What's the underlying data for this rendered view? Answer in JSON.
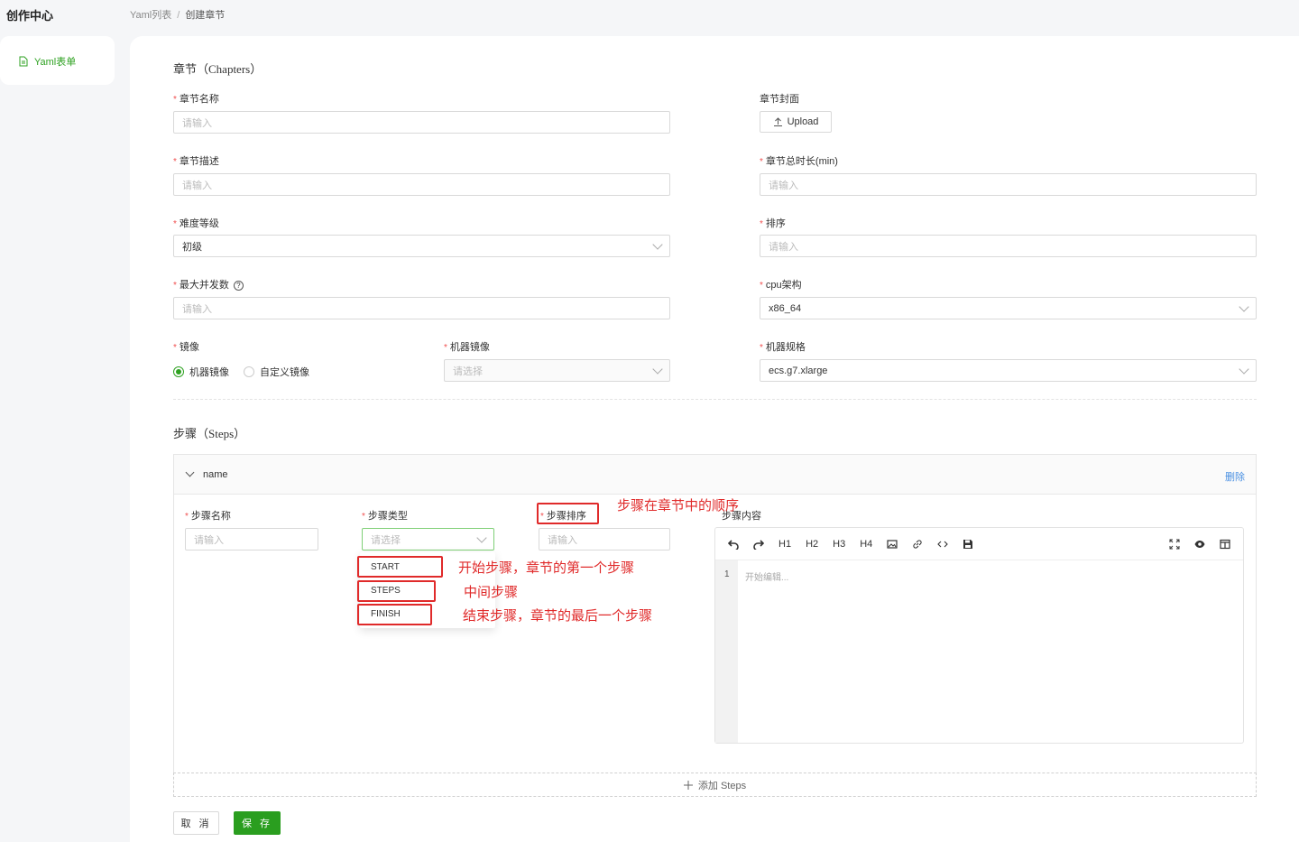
{
  "app": {
    "title": "创作中心"
  },
  "breadcrumb": {
    "items": [
      "Yaml列表",
      "创建章节"
    ],
    "separator": "/"
  },
  "sidebar": {
    "items": [
      {
        "label": "Yaml表单",
        "icon": "file-icon",
        "active": true
      }
    ]
  },
  "chapters": {
    "title": "章节（Chapters）",
    "fields": {
      "name": {
        "label": "章节名称",
        "placeholder": "请输入",
        "required": true
      },
      "cover": {
        "label": "章节封面",
        "button": "Upload",
        "required": false
      },
      "desc": {
        "label": "章节描述",
        "placeholder": "请输入",
        "required": true
      },
      "duration": {
        "label": "章节总时长(min)",
        "placeholder": "请输入",
        "required": true
      },
      "difficulty": {
        "label": "难度等级",
        "value": "初级",
        "required": true
      },
      "order": {
        "label": "排序",
        "placeholder": "请输入",
        "required": true
      },
      "concurrency": {
        "label": "最大并发数",
        "placeholder": "请输入",
        "required": true
      },
      "cpu_arch": {
        "label": "cpu架构",
        "value": "x86_64",
        "required": true
      },
      "image": {
        "label": "镜像",
        "options": [
          "机器镜像",
          "自定义镜像"
        ],
        "selected": "机器镜像",
        "required": true
      },
      "machine_image": {
        "label": "机器镜像",
        "placeholder": "请选择",
        "required": true
      },
      "machine_spec": {
        "label": "机器规格",
        "value": "ecs.g7.xlarge",
        "required": true
      }
    }
  },
  "steps": {
    "title": "步骤（Steps）",
    "panel": {
      "name": "name",
      "delete_label": "删除",
      "step_name": {
        "label": "步骤名称",
        "placeholder": "请输入"
      },
      "step_type": {
        "label": "步骤类型",
        "placeholder": "请选择",
        "options": [
          "START",
          "STEPS",
          "FINISH"
        ]
      },
      "step_order": {
        "label": "步骤排序",
        "placeholder": "请输入"
      },
      "step_content": {
        "label": "步骤内容"
      },
      "editor": {
        "toolbar": [
          "undo-icon",
          "redo-icon",
          "H1",
          "H2",
          "H3",
          "H4",
          "image-icon",
          "link-icon",
          "code-icon",
          "save-icon"
        ],
        "toolbar_right": [
          "fullscreen-icon",
          "preview-icon",
          "split-icon"
        ],
        "line_number": "1",
        "placeholder": "开始编辑..."
      }
    },
    "add_label": "添加 Steps"
  },
  "annotations": {
    "order": "步骤在章节中的顺序",
    "start": "开始步骤，章节的第一个步骤",
    "steps": "中间步骤",
    "finish": "结束步骤，章节的最后一个步骤",
    "color": "#e02a2a"
  },
  "actions": {
    "cancel": "取 消",
    "save": "保 存"
  },
  "colors": {
    "accent": "#2ea121",
    "link": "#4a90e2",
    "required": "#f05050"
  }
}
